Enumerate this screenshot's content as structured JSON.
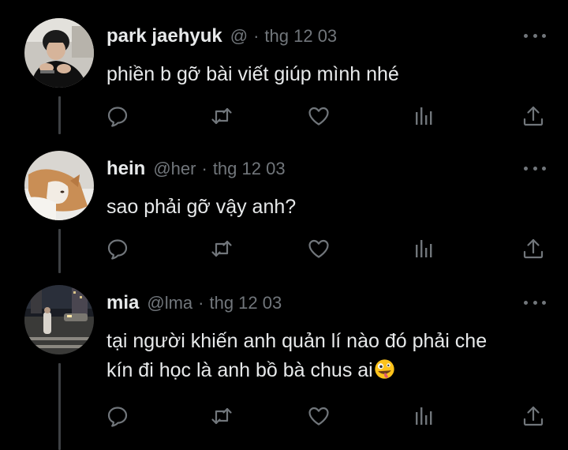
{
  "tweets": [
    {
      "name": "park jaehyuk",
      "handle": "@",
      "separator": "·",
      "date": "thg 12 03",
      "text": "phiền b gỡ bài viết giúp mình nhé",
      "avatar": "photo of young man with dark hair"
    },
    {
      "name": "hein",
      "handle": "@her",
      "separator": "·",
      "date": "thg 12 03",
      "text": "sao phải gỡ vậy anh?",
      "avatar": "photo of orange and white cat"
    },
    {
      "name": "mia",
      "handle": "@lma",
      "separator": "·",
      "date": "thg 12 03",
      "text_line1": "tại người khiến anh quản lí nào đó phải che",
      "text_line2": "kín đi học là anh bồ bà chus ai",
      "avatar": "night street photo"
    }
  ],
  "icons": {
    "reply": "reply-icon",
    "retweet": "retweet-icon",
    "like": "heart-icon",
    "views": "analytics-icon",
    "share": "share-icon",
    "more": "more-dots-icon",
    "emoji": "zany-face-emoji"
  },
  "colors": {
    "background": "#000000",
    "text": "#e7e9ea",
    "secondary": "#71767b",
    "thread_line": "#3e4144"
  }
}
